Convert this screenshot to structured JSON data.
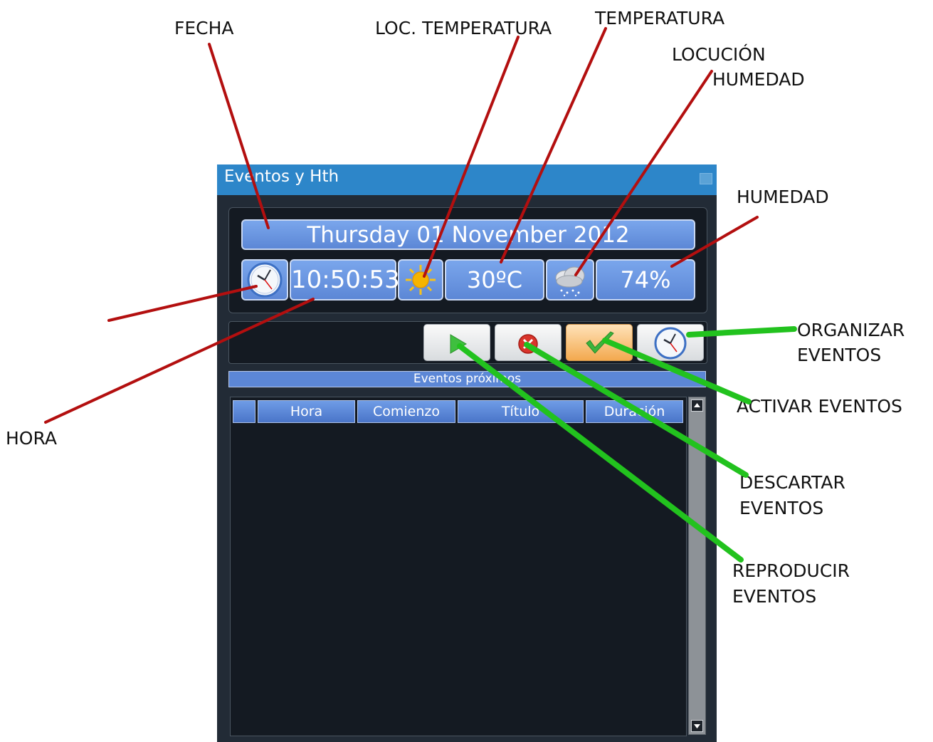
{
  "window": {
    "title": "Eventos y Hth",
    "date": "Thursday  01 November 2012",
    "time": "10:50:53",
    "temperature": "30ºC",
    "humidity": "74%",
    "events_header": "Eventos próximos",
    "columns": [
      "",
      "Hora",
      "Comienzo",
      "Título",
      "Duración"
    ]
  },
  "annotations": {
    "fecha": "FECHA",
    "loc_temperatura": "LOC. TEMPERATURA",
    "temperatura": "TEMPERATURA",
    "locucion": "LOCUCIÓN",
    "humedad_1": "HUMEDAD",
    "humedad_2": "HUMEDAD",
    "hora": "HORA",
    "organizar_1": "ORGANIZAR",
    "organizar_2": "EVENTOS",
    "activar": "ACTIVAR EVENTOS",
    "descartar_1": "DESCARTAR",
    "descartar_2": "EVENTOS",
    "reproducir_1": "REPRODUCIR",
    "reproducir_2": "EVENTOS"
  },
  "icons": {
    "clock": "clock-icon",
    "sun": "sun-icon",
    "cloud": "cloud-rain-icon",
    "play": "play-icon",
    "discard": "close-circle-icon",
    "activate": "checkmark-icon",
    "organize": "clock-icon"
  },
  "colors": {
    "titlebar": "#2d86c9",
    "window_bg": "#222b36",
    "blue_box": "#5c87d6",
    "red_line": "#b30f0f",
    "green_line": "#22c21e"
  }
}
